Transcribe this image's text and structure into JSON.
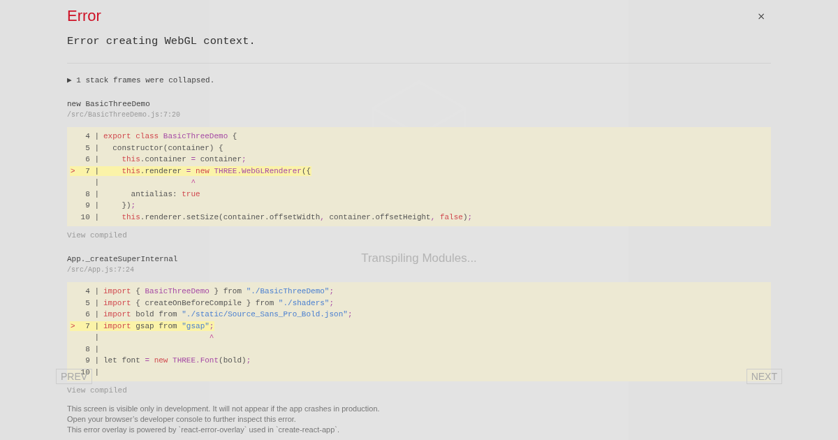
{
  "background": {
    "status": "Transpiling Modules...",
    "prev_button": "PREV",
    "next_button": "NEXT"
  },
  "overlay": {
    "title": "Error",
    "close": "×",
    "message": "Error creating WebGL context.",
    "collapsed": {
      "arrow": "▶",
      "text": "1 stack frames were collapsed."
    },
    "frames": [
      {
        "function": "new BasicThreeDemo",
        "file": "/src/BasicThreeDemo.js:7:20",
        "view_compiled": "View compiled",
        "lines": [
          {
            "gutter": "4 |",
            "highlighted": false,
            "tokens": [
              {
                "kind": "kw",
                "text": "export class"
              },
              {
                "kind": "cls",
                "text": " BasicThreeDemo"
              },
              {
                "kind": "plain",
                "text": " {"
              }
            ]
          },
          {
            "gutter": "5 |",
            "highlighted": false,
            "tokens": [
              {
                "kind": "plain",
                "text": "  constructor(container) {"
              }
            ]
          },
          {
            "gutter": "6 |",
            "highlighted": false,
            "tokens": [
              {
                "kind": "kw",
                "text": "    this"
              },
              {
                "kind": "plain",
                "text": ".container "
              },
              {
                "kind": "punc",
                "text": "="
              },
              {
                "kind": "plain",
                "text": " container"
              },
              {
                "kind": "punc",
                "text": ";"
              }
            ]
          },
          {
            "gutter": "7 |",
            "highlighted": true,
            "marker": ">",
            "tokens": [
              {
                "kind": "kw",
                "text": "    this"
              },
              {
                "kind": "plain",
                "text": ".renderer "
              },
              {
                "kind": "punc",
                "text": "="
              },
              {
                "kind": "kw",
                "text": " new"
              },
              {
                "kind": "cls",
                "text": " THREE.WebGLRenderer"
              },
              {
                "kind": "plain",
                "text": "({"
              }
            ]
          },
          {
            "gutter": "|",
            "highlighted": false,
            "tokens": [
              {
                "kind": "caret",
                "text": "                   ^"
              }
            ]
          },
          {
            "gutter": "8 |",
            "highlighted": false,
            "tokens": [
              {
                "kind": "plain",
                "text": "      antialias: "
              },
              {
                "kind": "kw",
                "text": "true"
              }
            ]
          },
          {
            "gutter": "9 |",
            "highlighted": false,
            "tokens": [
              {
                "kind": "plain",
                "text": "    })"
              },
              {
                "kind": "punc",
                "text": ";"
              }
            ]
          },
          {
            "gutter": "10 |",
            "highlighted": false,
            "tokens": [
              {
                "kind": "kw",
                "text": "    this"
              },
              {
                "kind": "plain",
                "text": ".renderer.setSize(container.offsetWidth"
              },
              {
                "kind": "punc",
                "text": ","
              },
              {
                "kind": "plain",
                "text": " container.offsetHeight"
              },
              {
                "kind": "punc",
                "text": ","
              },
              {
                "kind": "kw",
                "text": " false"
              },
              {
                "kind": "plain",
                "text": ")"
              },
              {
                "kind": "punc",
                "text": ";"
              }
            ]
          }
        ]
      },
      {
        "function": "App._createSuperInternal",
        "file": "/src/App.js:7:24",
        "view_compiled": "View compiled",
        "lines": [
          {
            "gutter": "4 |",
            "highlighted": false,
            "tokens": [
              {
                "kind": "kw",
                "text": "import"
              },
              {
                "kind": "plain",
                "text": " { "
              },
              {
                "kind": "cls",
                "text": "BasicThreeDemo"
              },
              {
                "kind": "plain",
                "text": " } from "
              },
              {
                "kind": "str",
                "text": "\"./BasicThreeDemo\""
              },
              {
                "kind": "punc",
                "text": ";"
              }
            ]
          },
          {
            "gutter": "5 |",
            "highlighted": false,
            "tokens": [
              {
                "kind": "kw",
                "text": "import"
              },
              {
                "kind": "plain",
                "text": " { createOnBeforeCompile } from "
              },
              {
                "kind": "str",
                "text": "\"./shaders\""
              },
              {
                "kind": "punc",
                "text": ";"
              }
            ]
          },
          {
            "gutter": "6 |",
            "highlighted": false,
            "tokens": [
              {
                "kind": "kw",
                "text": "import"
              },
              {
                "kind": "plain",
                "text": " bold from "
              },
              {
                "kind": "str",
                "text": "\"./static/Source_Sans_Pro_Bold.json\""
              },
              {
                "kind": "punc",
                "text": ";"
              }
            ]
          },
          {
            "gutter": "7 |",
            "highlighted": true,
            "marker": ">",
            "tokens": [
              {
                "kind": "kw",
                "text": "import"
              },
              {
                "kind": "plain",
                "text": " gsap from "
              },
              {
                "kind": "str",
                "text": "\"gsap\""
              },
              {
                "kind": "punc",
                "text": ";"
              }
            ]
          },
          {
            "gutter": "|",
            "highlighted": false,
            "tokens": [
              {
                "kind": "caret",
                "text": "                       ^"
              }
            ]
          },
          {
            "gutter": "8 |",
            "highlighted": false
          },
          {
            "gutter": "9 |",
            "highlighted": false,
            "tokens": [
              {
                "kind": "plain",
                "text": "let font "
              },
              {
                "kind": "punc",
                "text": "="
              },
              {
                "kind": "kw",
                "text": " new"
              },
              {
                "kind": "cls",
                "text": " THREE.Font"
              },
              {
                "kind": "plain",
                "text": "(bold)"
              },
              {
                "kind": "punc",
                "text": ";"
              }
            ]
          },
          {
            "gutter": "10 |",
            "highlighted": false
          }
        ]
      }
    ],
    "footer": [
      "This screen is visible only in development. It will not appear if the app crashes in production.",
      "Open your browser’s developer console to further inspect this error.",
      "This error overlay is powered by `react-error-overlay` used in `create-react-app`."
    ]
  }
}
